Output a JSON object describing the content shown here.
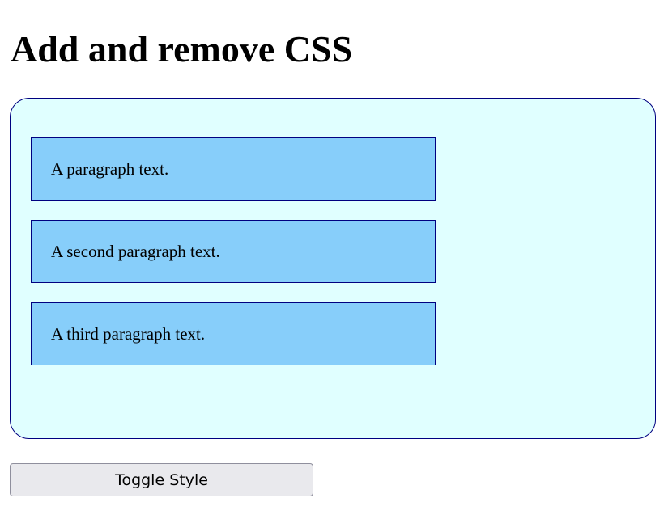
{
  "page": {
    "title": "Add and remove CSS"
  },
  "container": {
    "paragraphs": [
      "A paragraph text.",
      "A second paragraph text.",
      "A third paragraph text."
    ]
  },
  "toggle_button": {
    "label": "Toggle Style"
  },
  "colors": {
    "container_background": "#e0ffff",
    "container_border": "#000080",
    "paragraph_background": "#87cefa",
    "paragraph_border": "#000080",
    "button_background": "#e9e9ed"
  }
}
